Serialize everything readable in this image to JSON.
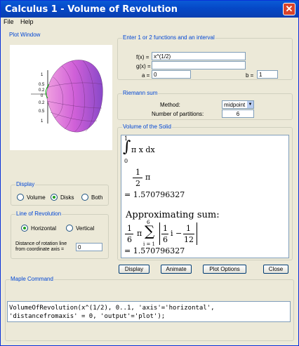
{
  "window": {
    "title": "Calculus 1 - Volume of Revolution"
  },
  "menu": {
    "file": "File",
    "help": "Help"
  },
  "plot": {
    "label": "Plot Window",
    "axis_ticks": [
      "1",
      "0.5",
      "0.2",
      "0",
      "0.2",
      "0.5",
      "1"
    ]
  },
  "functions": {
    "label": "Enter 1 or 2 functions and an interval",
    "f_label": "f(x) =",
    "f_value": "x^(1/2)",
    "g_label": "g(x) =",
    "g_value": "",
    "a_label": "a =",
    "a_value": "0",
    "b_label": "b =",
    "b_value": "1"
  },
  "riemann": {
    "label": "Riemann sum",
    "method_label": "Method:",
    "method_value": "midpoint",
    "partitions_label": "Number of partitions:",
    "partitions_value": "6"
  },
  "volume": {
    "label": "Volume of the Solid",
    "integral_upper": "1",
    "integral_lower": "0",
    "integrand": "π x  dx",
    "half_num": "1",
    "half_den": "2",
    "pi": "π",
    "result1": "= 1.570796327",
    "approx_label": "Approximating sum:",
    "sum_coef_num": "1",
    "sum_coef_den": "6",
    "sum_upper": "6",
    "sum_lower": "i = 1",
    "sum_sym": "∑",
    "inner_num1": "1",
    "inner_den1": "6",
    "inner_i": "i −",
    "inner_num2": "1",
    "inner_den2": "12",
    "result2": "= 1.570796327"
  },
  "display": {
    "label": "Display",
    "volume": "Volume",
    "disks": "Disks",
    "both": "Both",
    "selected": "Disks"
  },
  "line_rev": {
    "label": "Line of Revolution",
    "horizontal": "Horizontal",
    "vertical": "Vertical",
    "selected": "Horizontal",
    "distance_label_1": "Distance of rotation line",
    "distance_label_2": "from coordinate axis =",
    "distance_value": "0"
  },
  "buttons": {
    "display": "Display",
    "animate": "Animate",
    "plot_options": "Plot Options",
    "close": "Close"
  },
  "maple": {
    "label": "Maple Command",
    "line1": "VolumeOfRevolution(x^(1/2), 0..1, 'axis'='horizontal',",
    "line2": "'distancefromaxis' = 0, 'output'='plot');"
  },
  "colors": {
    "titlebar": "#0548c7",
    "group_label": "#0046d5",
    "surface": "#e070d0"
  }
}
